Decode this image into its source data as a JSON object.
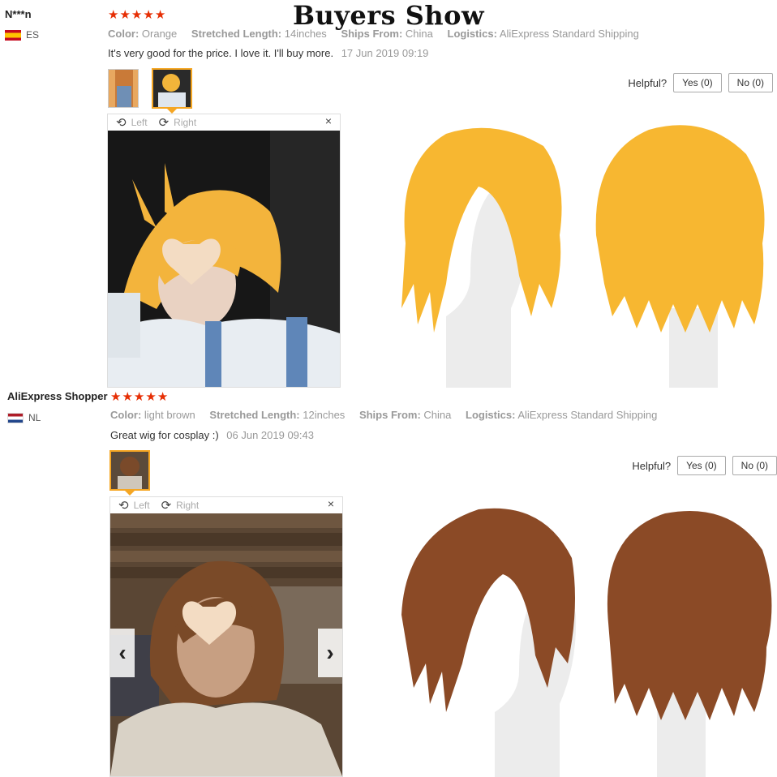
{
  "title": "Buyers Show",
  "reviews": [
    {
      "username": "N***n",
      "country": "ES",
      "stars": 5,
      "meta": [
        {
          "key": "Color:",
          "value": "Orange"
        },
        {
          "key": "Stretched Length:",
          "value": "14inches"
        },
        {
          "key": "Ships From:",
          "value": "China"
        },
        {
          "key": "Logistics:",
          "value": "AliExpress Standard Shipping"
        }
      ],
      "comment": "It's very good for the price. I love it. I'll buy more.",
      "date": "17 Jun 2019 09:19",
      "viewer": {
        "left_label": "Left",
        "right_label": "Right",
        "close": "×"
      },
      "helpful": {
        "label": "Helpful?",
        "yes": "Yes (0)",
        "no": "No (0)"
      },
      "wig_color": "#f7b731"
    },
    {
      "username": "AliExpress Shopper",
      "country": "NL",
      "stars": 5,
      "meta": [
        {
          "key": "Color:",
          "value": "light brown"
        },
        {
          "key": "Stretched Length:",
          "value": "12inches"
        },
        {
          "key": "Ships From:",
          "value": "China"
        },
        {
          "key": "Logistics:",
          "value": "AliExpress Standard Shipping"
        }
      ],
      "comment": "Great wig for cosplay :)",
      "date": "06 Jun 2019 09:43",
      "viewer": {
        "left_label": "Left",
        "right_label": "Right",
        "close": "×",
        "prev": "‹",
        "next": "›"
      },
      "helpful": {
        "label": "Helpful?",
        "yes": "Yes (0)",
        "no": "No (0)"
      },
      "wig_color": "#8b4a26"
    }
  ],
  "icons": {
    "star": "★",
    "rotate_left": "⟲",
    "rotate_right": "⟳"
  }
}
